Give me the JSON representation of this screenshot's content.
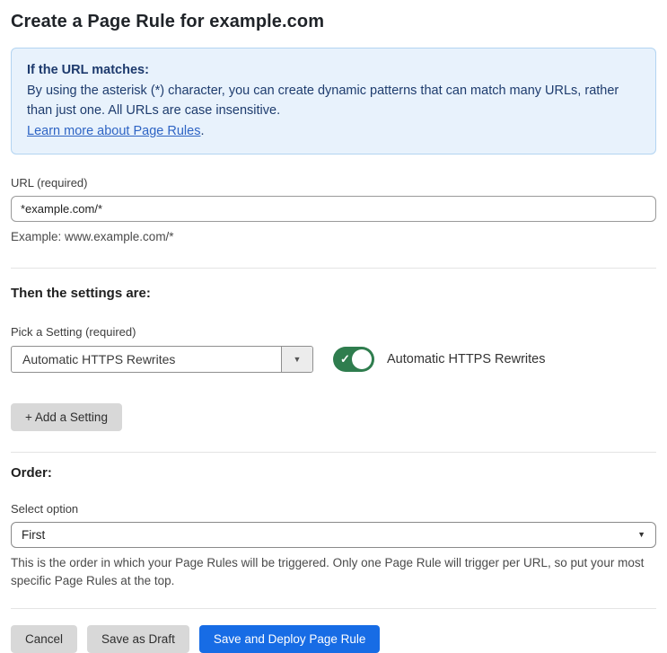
{
  "page": {
    "title": "Create a Page Rule for example.com"
  },
  "info_box": {
    "heading": "If the URL matches:",
    "body": "By using the asterisk (*) character, you can create dynamic patterns that can match many URLs, rather than just one. All URLs are case insensitive.",
    "link_text": "Learn more about Page Rules",
    "link_suffix": "."
  },
  "url_field": {
    "label": "URL (required)",
    "value": "*example.com/*",
    "helper": "Example: www.example.com/*"
  },
  "settings_section": {
    "heading": "Then the settings are:",
    "picker_label": "Pick a Setting (required)",
    "selected_setting": "Automatic HTTPS Rewrites",
    "dropdown_arrow": "▼",
    "toggle_state": "on",
    "toggle_check": "✓",
    "toggle_label": "Automatic HTTPS Rewrites",
    "add_button_label": "+ Add a Setting"
  },
  "order_section": {
    "heading": "Order:",
    "label": "Select option",
    "selected_option": "First",
    "select_arrow": "▼",
    "helper": "This is the order in which your Page Rules will be triggered. Only one Page Rule will trigger per URL, so put your most specific Page Rules at the top."
  },
  "actions": {
    "cancel_label": "Cancel",
    "save_draft_label": "Save as Draft",
    "save_deploy_label": "Save and Deploy Page Rule"
  },
  "colors": {
    "info_bg": "#e8f2fc",
    "info_border": "#b3d4f1",
    "info_text": "#1e3c6e",
    "link_blue": "#2e64c4",
    "toggle_on_green": "#2f7d4e",
    "primary_button_blue": "#176ce5",
    "secondary_button_gray": "#d8d8d8"
  }
}
